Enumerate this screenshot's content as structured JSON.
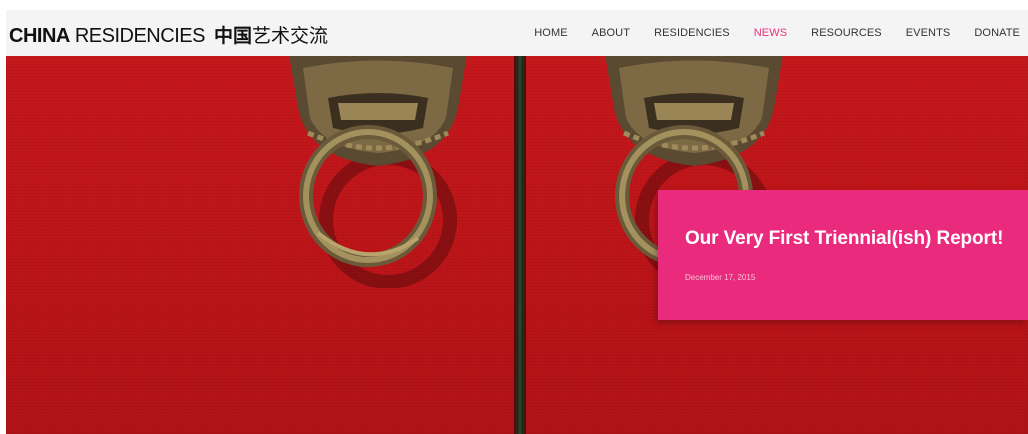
{
  "header": {
    "logo": {
      "bold": "CHINA",
      "light": "RESIDENCIES",
      "zh_bold": "中国",
      "zh_light": "艺术交流"
    },
    "nav": {
      "items": [
        {
          "label": "HOME"
        },
        {
          "label": "ABOUT"
        },
        {
          "label": "RESIDENCIES"
        },
        {
          "label": "NEWS",
          "active": true
        },
        {
          "label": "RESOURCES"
        },
        {
          "label": "EVENTS"
        },
        {
          "label": "DONATE"
        }
      ]
    }
  },
  "hero": {
    "image": "red-doors-knockers-image",
    "post": {
      "title": "Our Very First Triennial(ish) Report!",
      "date": "December 17, 2015"
    }
  },
  "colors": {
    "accent": "#e8317a",
    "card": "#ea2a7c",
    "door_red": "#c7181c",
    "header_bg": "#f4f4f4"
  }
}
